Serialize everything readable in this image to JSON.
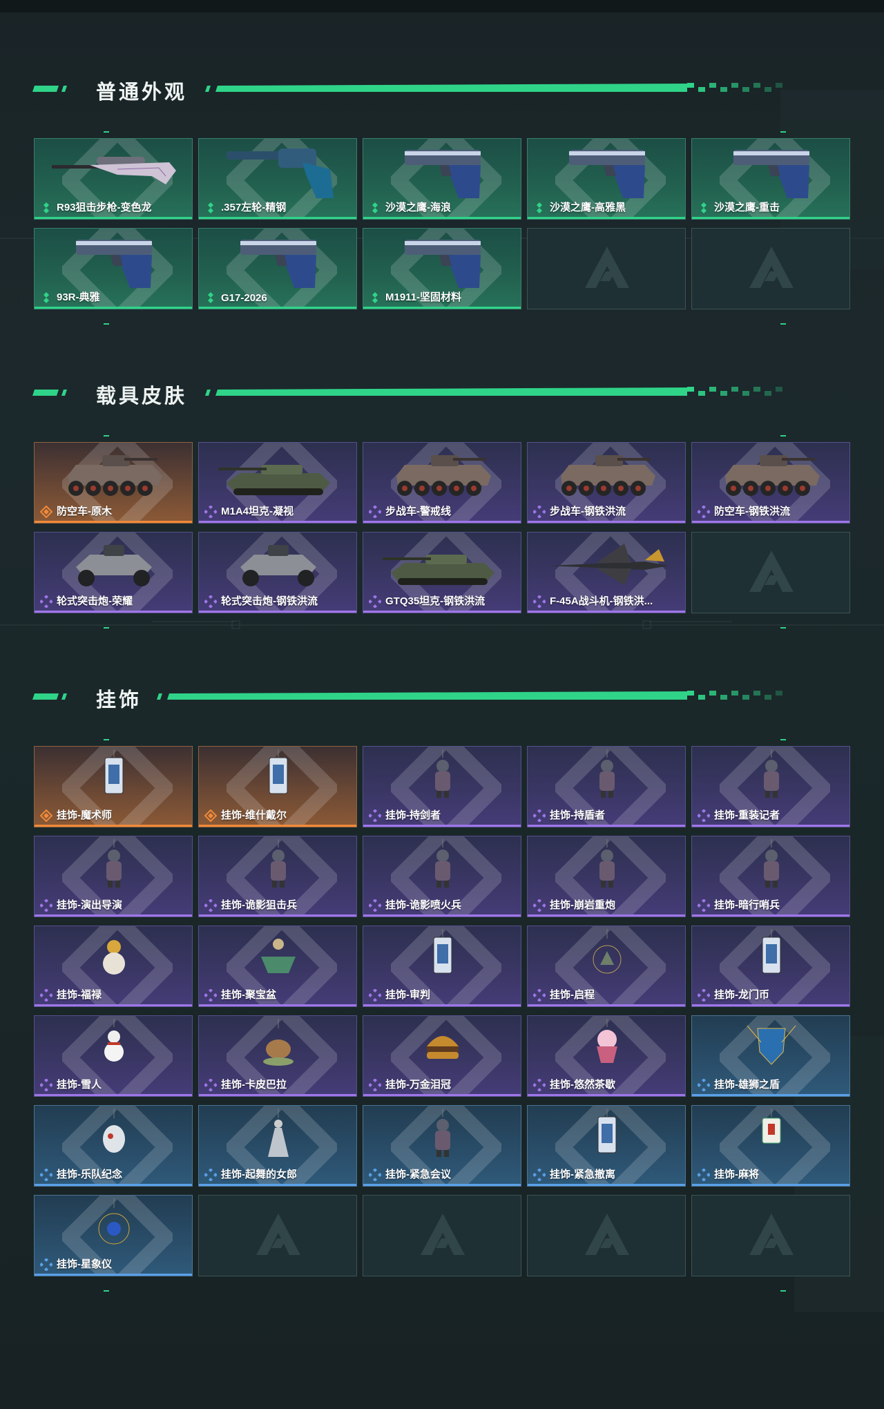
{
  "sections": [
    {
      "title": "普通外观",
      "items": [
        {
          "label": "R93狙击步枪-变色龙",
          "rarity": "green",
          "icon": "sniper-rifle-icon"
        },
        {
          "label": ".357左轮-精钢",
          "rarity": "green",
          "icon": "revolver-icon"
        },
        {
          "label": "沙漠之鹰-海浪",
          "rarity": "green",
          "icon": "pistol-icon"
        },
        {
          "label": "沙漠之鹰-高雅黑",
          "rarity": "green",
          "icon": "pistol-icon"
        },
        {
          "label": "沙漠之鹰-重击",
          "rarity": "green",
          "icon": "pistol-icon"
        },
        {
          "label": "93R-典雅",
          "rarity": "green",
          "icon": "pistol-icon"
        },
        {
          "label": "G17-2026",
          "rarity": "green",
          "icon": "pistol-icon"
        },
        {
          "label": "M1911-坚固材料",
          "rarity": "green",
          "icon": "pistol-icon"
        },
        {
          "label": "",
          "rarity": "empty",
          "icon": "placeholder-logo-icon"
        },
        {
          "label": "",
          "rarity": "empty",
          "icon": "placeholder-logo-icon"
        }
      ]
    },
    {
      "title": "载具皮肤",
      "items": [
        {
          "label": "防空车-原木",
          "rarity": "orange",
          "icon": "apc-icon"
        },
        {
          "label": "M1A4坦克-凝视",
          "rarity": "purple",
          "icon": "tank-icon"
        },
        {
          "label": "步战车-警戒线",
          "rarity": "purple",
          "icon": "apc-icon"
        },
        {
          "label": "步战车-钢铁洪流",
          "rarity": "purple",
          "icon": "apc-icon"
        },
        {
          "label": "防空车-钢铁洪流",
          "rarity": "purple",
          "icon": "apc-icon"
        },
        {
          "label": "轮式突击炮-荣耀",
          "rarity": "purple",
          "icon": "buggy-icon"
        },
        {
          "label": "轮式突击炮-钢铁洪流",
          "rarity": "purple",
          "icon": "buggy-icon"
        },
        {
          "label": "GTQ35坦克-钢铁洪流",
          "rarity": "purple",
          "icon": "tank-icon"
        },
        {
          "label": "F-45A战斗机-钢铁洪...",
          "rarity": "purple",
          "icon": "jet-icon"
        },
        {
          "label": "",
          "rarity": "empty",
          "icon": "placeholder-logo-icon"
        }
      ]
    },
    {
      "title": "挂饰",
      "items": [
        {
          "label": "挂饰-魔术师",
          "rarity": "orange",
          "icon": "card-charm-icon"
        },
        {
          "label": "挂饰-维什戴尔",
          "rarity": "orange",
          "icon": "card-charm-icon"
        },
        {
          "label": "挂饰-持剑者",
          "rarity": "purple",
          "icon": "figure-charm-icon"
        },
        {
          "label": "挂饰-持盾者",
          "rarity": "purple",
          "icon": "figure-charm-icon"
        },
        {
          "label": "挂饰-重装记者",
          "rarity": "purple",
          "icon": "figure-charm-icon"
        },
        {
          "label": "挂饰-演出导演",
          "rarity": "purple",
          "icon": "figure-charm-icon"
        },
        {
          "label": "挂饰-诡影狙击兵",
          "rarity": "purple",
          "icon": "figure-charm-icon"
        },
        {
          "label": "挂饰-诡影喷火兵",
          "rarity": "purple",
          "icon": "figure-charm-icon"
        },
        {
          "label": "挂饰-崩岩重炮",
          "rarity": "purple",
          "icon": "figure-charm-icon"
        },
        {
          "label": "挂饰-暗行哨兵",
          "rarity": "purple",
          "icon": "figure-charm-icon"
        },
        {
          "label": "挂饰-福禄",
          "rarity": "purple",
          "icon": "gourd-charm-icon"
        },
        {
          "label": "挂饰-聚宝盆",
          "rarity": "purple",
          "icon": "bowl-charm-icon"
        },
        {
          "label": "挂饰-审判",
          "rarity": "purple",
          "icon": "card-charm-icon"
        },
        {
          "label": "挂饰-启程",
          "rarity": "purple",
          "icon": "ring-charm-icon"
        },
        {
          "label": "挂饰-龙门币",
          "rarity": "purple",
          "icon": "card-charm-icon"
        },
        {
          "label": "挂饰-雪人",
          "rarity": "purple",
          "icon": "snowman-charm-icon"
        },
        {
          "label": "挂饰-卡皮巴拉",
          "rarity": "purple",
          "icon": "capybara-charm-icon"
        },
        {
          "label": "挂饰-万金泪冠",
          "rarity": "purple",
          "icon": "burger-charm-icon"
        },
        {
          "label": "挂饰-悠然茶歇",
          "rarity": "purple",
          "icon": "cupcake-charm-icon"
        },
        {
          "label": "挂饰-雄狮之盾",
          "rarity": "blue",
          "icon": "shield-charm-icon"
        },
        {
          "label": "挂饰-乐队纪念",
          "rarity": "blue",
          "icon": "egg-charm-icon"
        },
        {
          "label": "挂饰-起舞的女郎",
          "rarity": "blue",
          "icon": "dancer-charm-icon"
        },
        {
          "label": "挂饰-紧急会议",
          "rarity": "blue",
          "icon": "figure-charm-icon"
        },
        {
          "label": "挂饰-紧急撤离",
          "rarity": "blue",
          "icon": "card-charm-icon"
        },
        {
          "label": "挂饰-麻将",
          "rarity": "blue",
          "icon": "mahjong-charm-icon"
        },
        {
          "label": "挂饰-星象仪",
          "rarity": "blue",
          "icon": "orrery-charm-icon"
        },
        {
          "label": "",
          "rarity": "empty",
          "icon": "placeholder-logo-icon"
        },
        {
          "label": "",
          "rarity": "empty",
          "icon": "placeholder-logo-icon"
        },
        {
          "label": "",
          "rarity": "empty",
          "icon": "placeholder-logo-icon"
        },
        {
          "label": "",
          "rarity": "empty",
          "icon": "placeholder-logo-icon"
        }
      ]
    }
  ],
  "colors": {
    "accent_green": "#2fd489",
    "rarity_green": "#2fd489",
    "rarity_purple": "#9f76e8",
    "rarity_orange": "#f08a3a",
    "rarity_blue": "#5aa0e8"
  }
}
